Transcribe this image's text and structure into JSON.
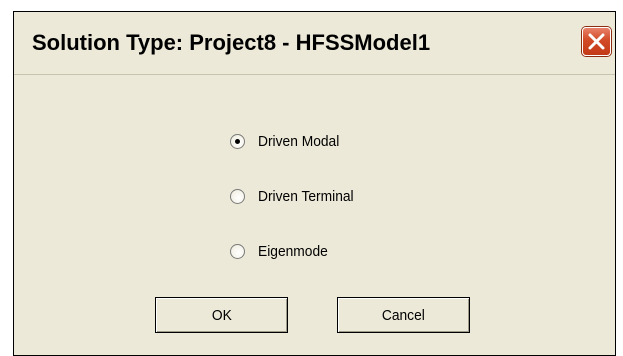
{
  "dialog": {
    "title": "Solution Type: Project8 - HFSSModel1",
    "close_icon": "close-icon"
  },
  "options": [
    {
      "label": "Driven Modal",
      "selected": true
    },
    {
      "label": "Driven Terminal",
      "selected": false
    },
    {
      "label": "Eigenmode",
      "selected": false
    }
  ],
  "buttons": {
    "ok_label": "OK",
    "cancel_label": "Cancel"
  },
  "colors": {
    "face": "#ece9d8",
    "close_button": "#d24a26"
  }
}
